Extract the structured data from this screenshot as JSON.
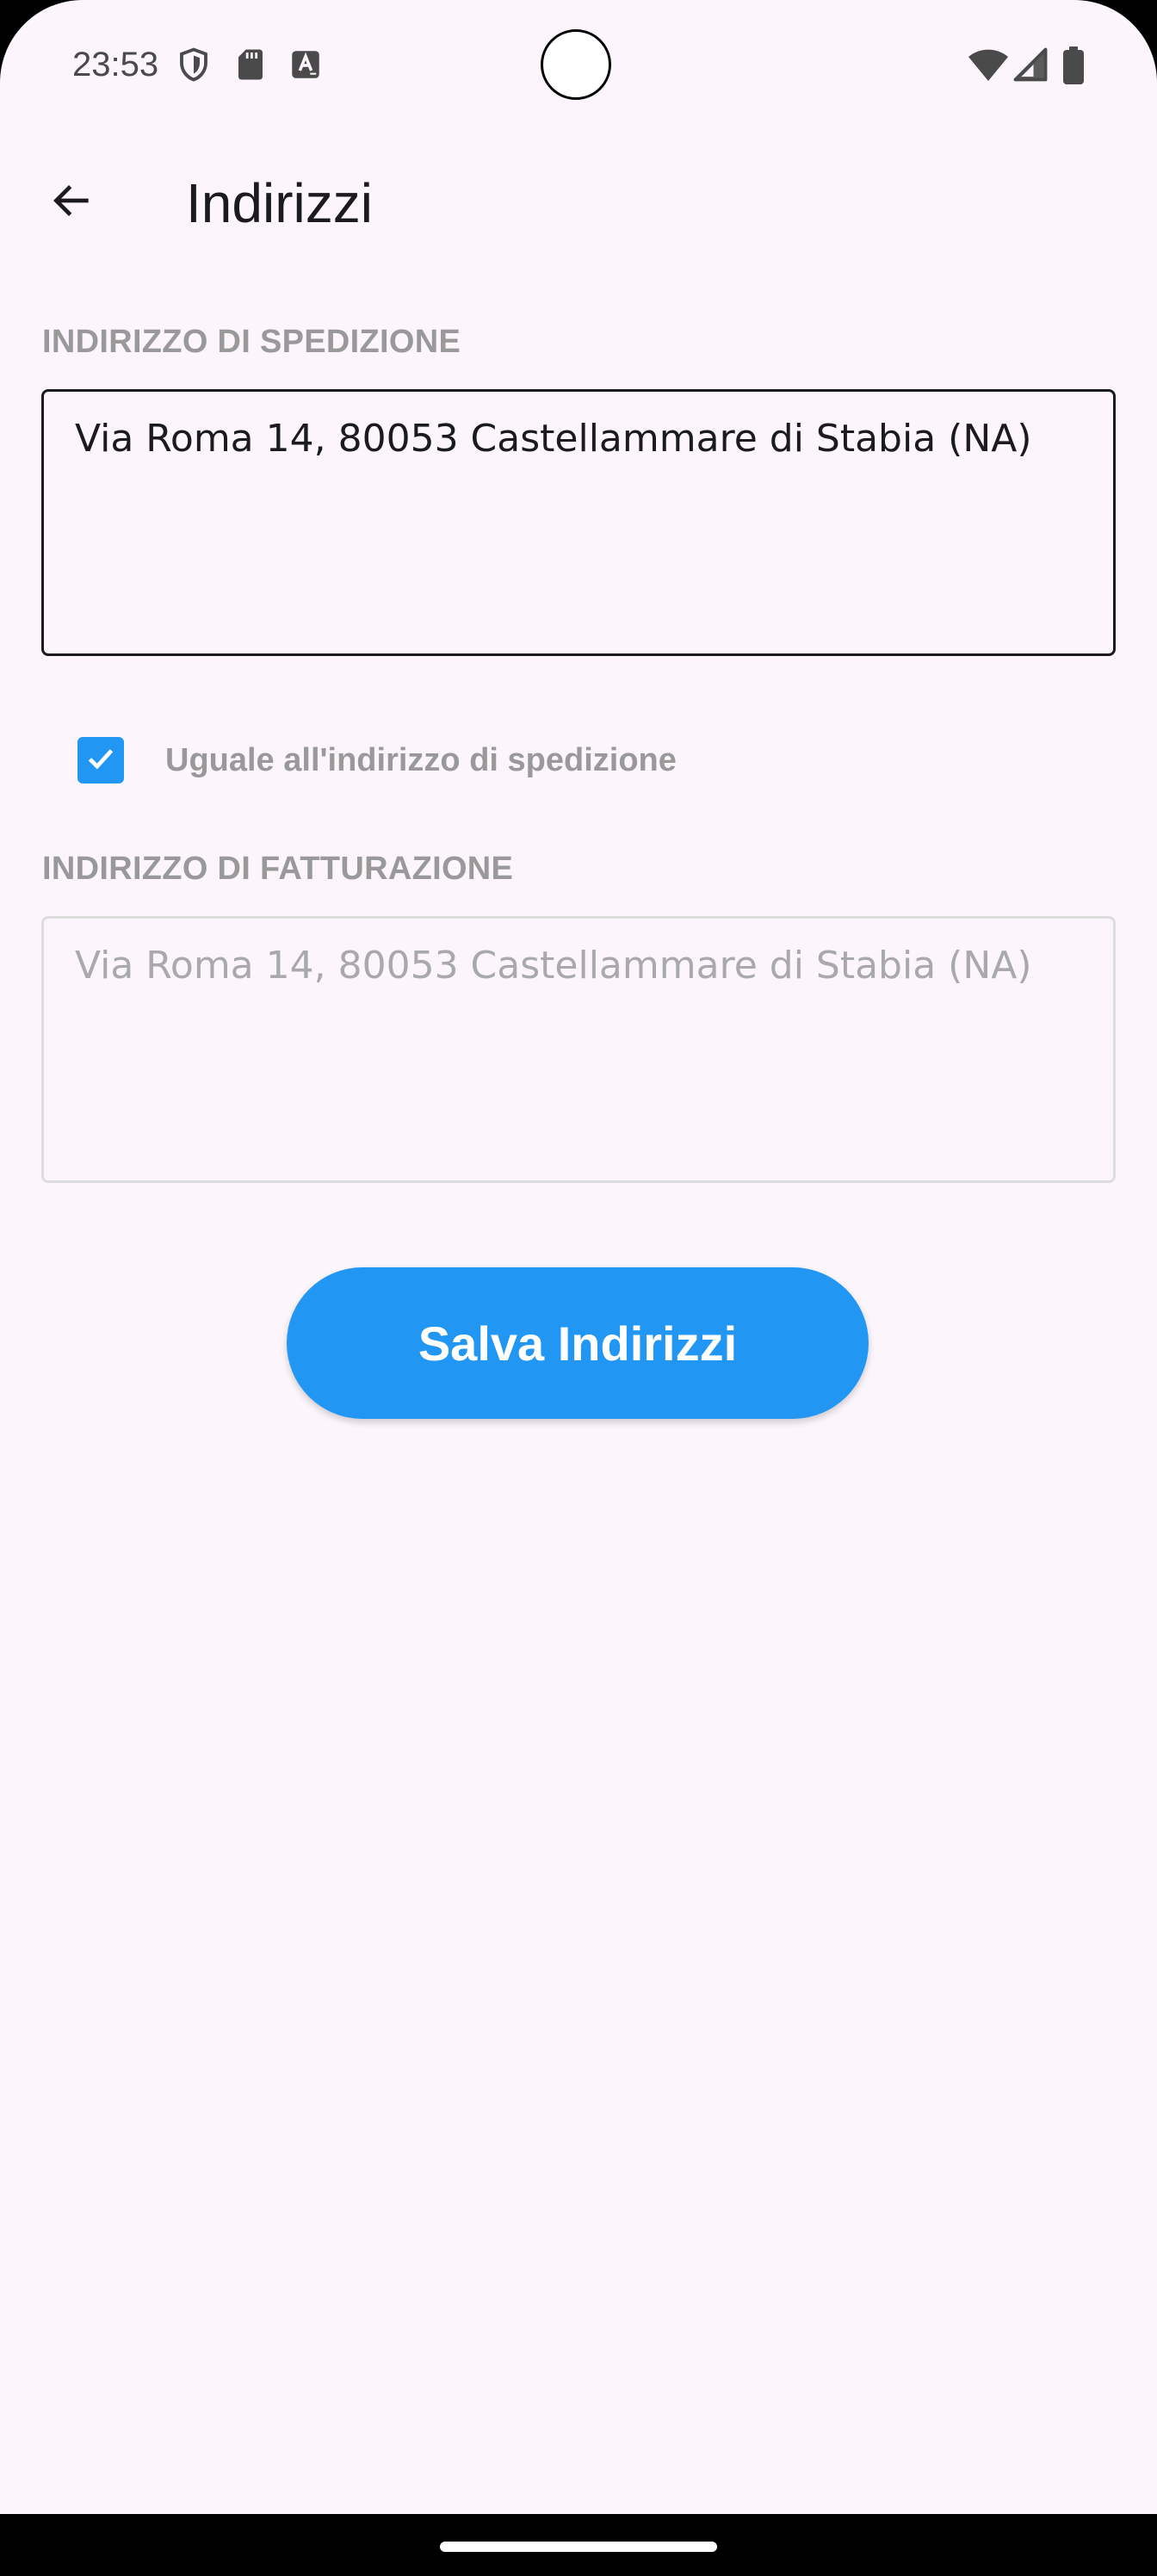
{
  "status_bar": {
    "time": "23:53",
    "left_icons": [
      "shield-icon",
      "sd-card-icon",
      "keyboard-a-icon"
    ],
    "right_icons": [
      "wifi-icon",
      "signal-icon",
      "battery-icon"
    ]
  },
  "app_bar": {
    "back_icon": "arrow-back-icon",
    "title": "Indirizzi"
  },
  "form": {
    "shipping_label": "INDIRIZZO DI SPEDIZIONE",
    "shipping_value": "Via Roma 14, 80053 Castellammare di Stabia (NA)",
    "same_as_shipping_checked": true,
    "same_as_shipping_label": "Uguale all'indirizzo di spedizione",
    "billing_label": "INDIRIZZO DI FATTURAZIONE",
    "billing_value": "Via Roma 14, 80053 Castellammare di Stabia (NA)",
    "save_label": "Salva Indirizzi"
  },
  "colors": {
    "accent": "#2196f3",
    "background": "#fcf6fc",
    "label_gray": "#999999",
    "disabled_text": "#a9a9a9"
  }
}
